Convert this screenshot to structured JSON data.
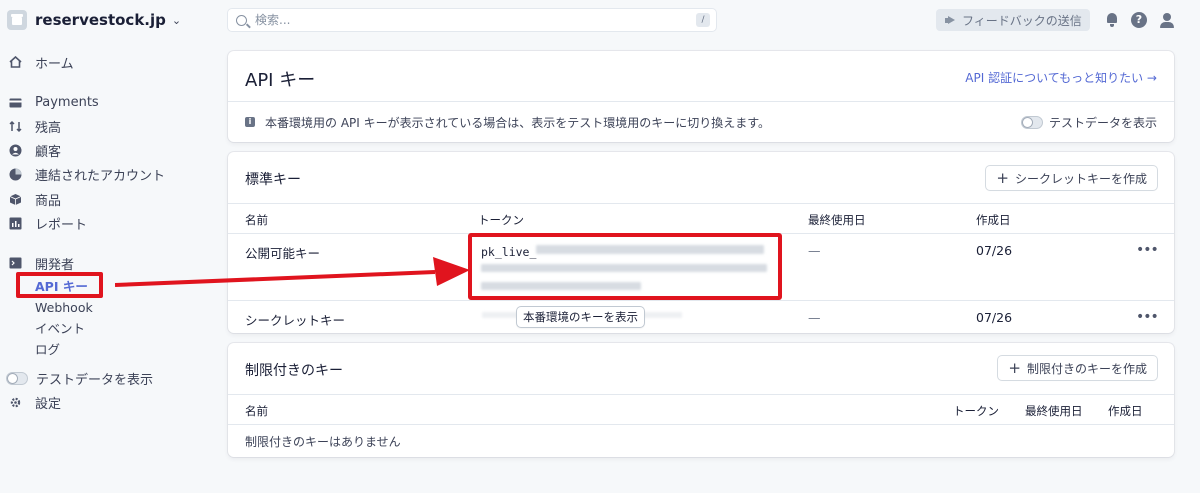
{
  "account": {
    "name": "reservestock.jp"
  },
  "sidebar": {
    "items": [
      {
        "label": "ホーム",
        "icon": "home-icon"
      },
      {
        "label": "Payments",
        "icon": "payments-icon"
      },
      {
        "label": "残高",
        "icon": "balance-icon"
      },
      {
        "label": "顧客",
        "icon": "customers-icon"
      },
      {
        "label": "連結されたアカウント",
        "icon": "connected-accounts-icon"
      },
      {
        "label": "商品",
        "icon": "products-icon"
      },
      {
        "label": "レポート",
        "icon": "reports-icon"
      },
      {
        "label": "開発者",
        "icon": "developers-icon"
      }
    ],
    "developer_sub": [
      "API キー",
      "Webhook",
      "イベント",
      "ログ"
    ],
    "test_data_toggle": "テストデータを表示",
    "settings": "設定"
  },
  "search": {
    "placeholder": "検索...",
    "shortcut": "/"
  },
  "topbar": {
    "feedback": "フィードバックの送信",
    "help": "?"
  },
  "api_card": {
    "title": "API キー",
    "learn_more": "API 認証についてもっと知りたい →",
    "notice": "本番環境用の API キーが表示されている場合は、表示をテスト環境用のキーに切り換えます。",
    "toggle_label": "テストデータを表示"
  },
  "standard_keys": {
    "title": "標準キー",
    "create_button": "シークレットキーを作成",
    "columns": [
      "名前",
      "トークン",
      "最終使用日",
      "作成日"
    ],
    "rows": [
      {
        "name": "公開可能キー",
        "token_prefix": "pk_live_",
        "last_used": "—",
        "created": "07/26"
      },
      {
        "name": "シークレットキー",
        "token_prefix": "",
        "last_used": "—",
        "created": "07/26"
      }
    ],
    "reveal_button": "本番環境のキーを表示"
  },
  "restricted_keys": {
    "title": "制限付きのキー",
    "create_button": "制限付きのキーを作成",
    "columns": [
      "名前",
      "トークン",
      "最終使用日",
      "作成日"
    ],
    "empty": "制限付きのキーはありません"
  },
  "colors": {
    "accent": "#5469d4",
    "annotation": "#e0141e",
    "background": "#f6f8fa"
  }
}
